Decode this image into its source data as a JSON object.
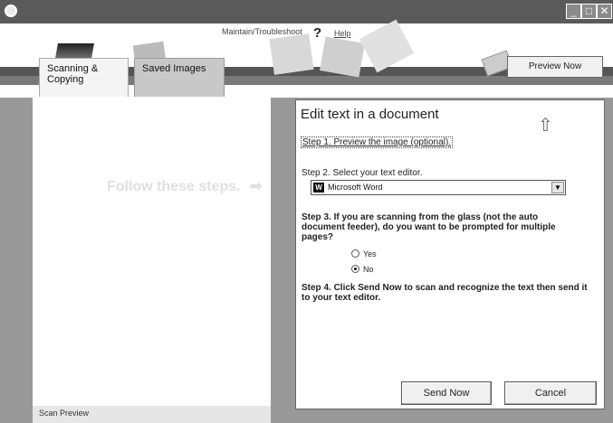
{
  "header": {
    "maintain_link": "Maintain/Troubleshoot",
    "help_link": "Help",
    "preview_button": "Preview Now",
    "tabs": [
      {
        "label": "Scanning & Copying"
      },
      {
        "label": "Saved Images"
      }
    ]
  },
  "left_pane": {
    "follow_text": "Follow these steps.",
    "arrow": "➡",
    "footer_label": "Scan Preview"
  },
  "panel": {
    "title": "Edit text in a document",
    "step1": "Step 1. Preview the image (optional).",
    "step2": "Step 2.  Select your text editor.",
    "editor_selected": "Microsoft Word",
    "step3": "Step 3.  If you are scanning from the glass (not the auto document feeder), do you want to be prompted for multiple pages?",
    "radio_yes": "Yes",
    "radio_no": "No",
    "radio_selected": "No",
    "step4": "Step 4.  Click Send Now to scan and recognize the text then send it to your text editor.",
    "send_now": "Send Now",
    "cancel": "Cancel"
  },
  "icons": [
    "app-logo-icon",
    "minimize-icon",
    "maximize-icon",
    "close-icon",
    "help-icon",
    "word-icon",
    "dropdown-arrow-icon",
    "upload-icon",
    "arrow-right-icon"
  ],
  "colors": {
    "titlebar": "#5a5a5a",
    "body": "#999999",
    "panel": "#ffffff"
  }
}
